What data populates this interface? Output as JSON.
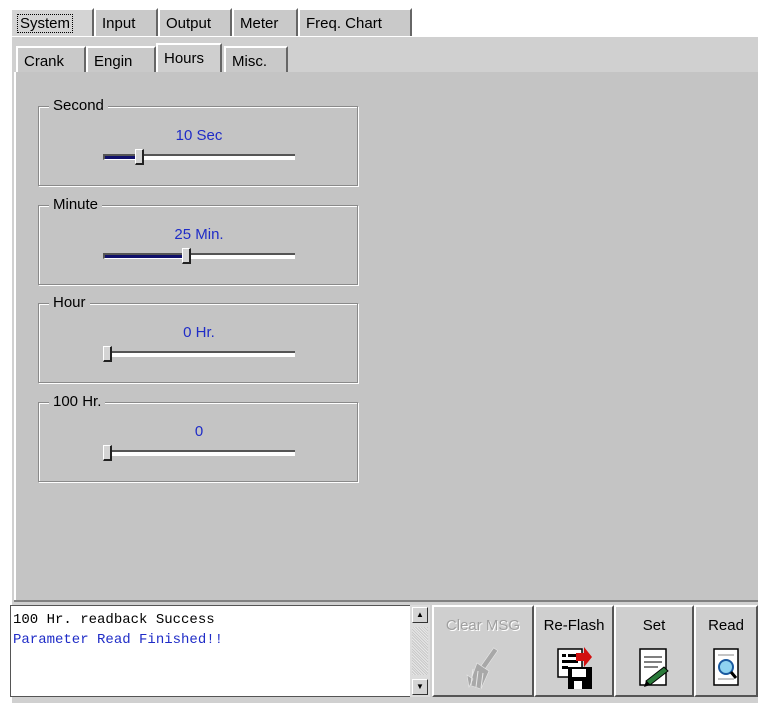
{
  "outer_tabs": [
    {
      "label": "System",
      "active": true
    },
    {
      "label": "Input",
      "active": false
    },
    {
      "label": "Output",
      "active": false
    },
    {
      "label": "Meter",
      "active": false
    },
    {
      "label": "Freq. Chart",
      "active": false
    }
  ],
  "inner_tabs": [
    {
      "label": "Crank",
      "active": false
    },
    {
      "label": "Engin",
      "active": false
    },
    {
      "label": "Hours",
      "active": true
    },
    {
      "label": "Misc.",
      "active": false
    }
  ],
  "groups": [
    {
      "title": "Second",
      "value_text": "10 Sec",
      "slider_fraction": 0.17
    },
    {
      "title": "Minute",
      "value_text": "25 Min.",
      "slider_fraction": 0.42
    },
    {
      "title": "Hour",
      "value_text": "0 Hr.",
      "slider_fraction": 0.0
    },
    {
      "title": "100 Hr.",
      "value_text": "0",
      "slider_fraction": 0.0
    }
  ],
  "messages": {
    "line1": "100 Hr. readback Success",
    "line2": "Parameter Read Finished!!"
  },
  "buttons": {
    "clear_msg": {
      "label": "Clear MSG",
      "enabled": false,
      "icon": "broom-icon"
    },
    "reflash": {
      "label": "Re-Flash",
      "enabled": true,
      "icon": "floppy-save-icon"
    },
    "set": {
      "label": "Set",
      "enabled": true,
      "icon": "document-write-icon"
    },
    "read": {
      "label": "Read",
      "enabled": true,
      "icon": "document-search-icon"
    }
  },
  "colors": {
    "value_text": "#1f2cc7",
    "panel": "#c4c4c4",
    "slider_fill": "#10106a"
  }
}
